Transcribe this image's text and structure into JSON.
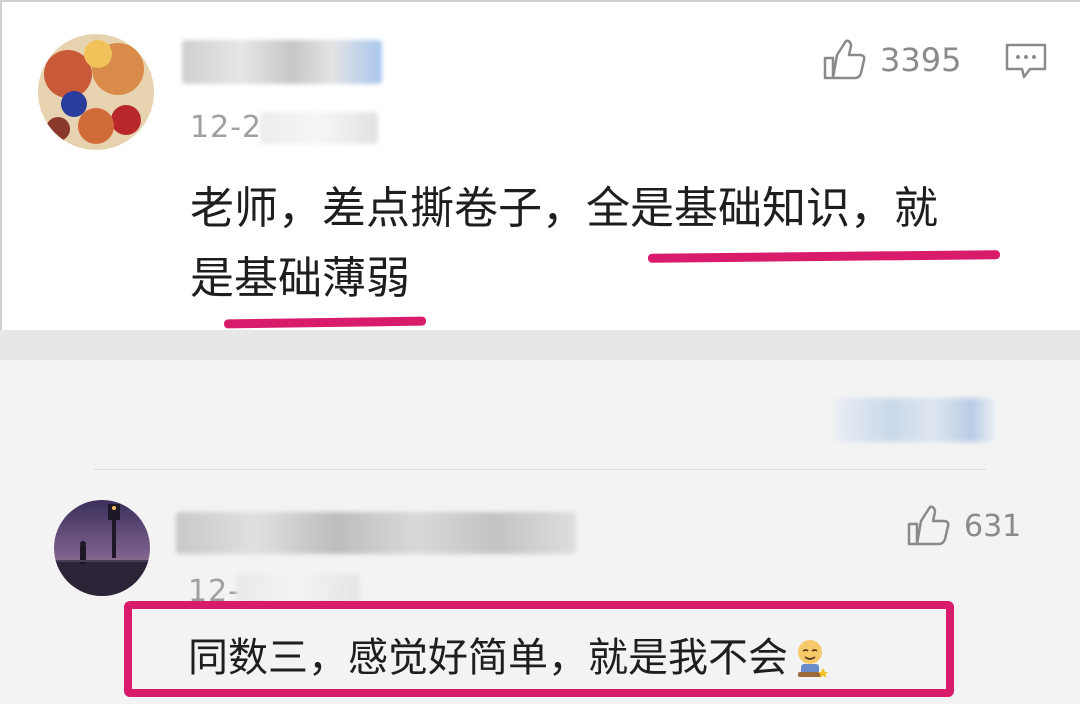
{
  "comment1": {
    "likes": "3395",
    "date_prefix": "12-2",
    "text_line1_a": "老师，差点撕卷子，",
    "text_line1_b": "全是基础知识",
    "text_line1_c": "，就",
    "text_line2_a": "是",
    "text_line2_b": "基础薄弱"
  },
  "comment2": {
    "likes": "631",
    "date_prefix": "12-",
    "text": "同数三，感觉好简单，就是我不会",
    "emoji_name": "sweat-smile-emoji"
  },
  "icons": {
    "like": "thumbs-up-icon",
    "reply": "comment-bubble-icon"
  },
  "colors": {
    "accent": "#d81b6a",
    "meta": "#a0a0a0"
  }
}
